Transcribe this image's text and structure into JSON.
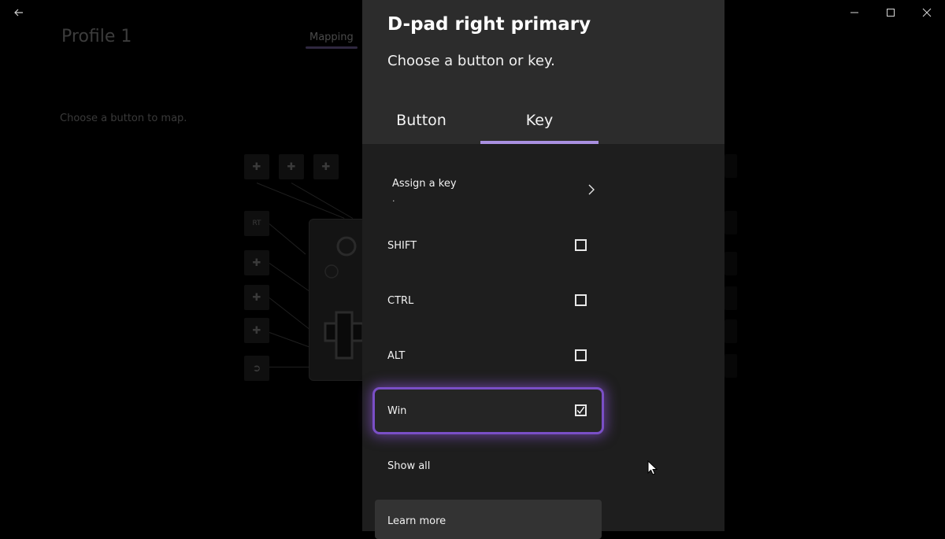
{
  "window": {
    "back_icon": "back-arrow-icon",
    "minimize_icon": "minimize-icon",
    "maximize_icon": "maximize-icon",
    "close_icon": "close-icon"
  },
  "background": {
    "profile_title": "Profile 1",
    "tab_mapping": "Mapping",
    "instruction": "Choose a button to map.",
    "indicator_ax": "RT"
  },
  "dialog": {
    "title": "D-pad right primary",
    "subtitle": "Choose a button or key.",
    "tabs": [
      {
        "label": "Button",
        "selected": false
      },
      {
        "label": "Key",
        "selected": true
      }
    ],
    "assign": {
      "label": "Assign a key",
      "value": "."
    },
    "modifiers": [
      {
        "label": "SHIFT",
        "checked": false,
        "focused": false
      },
      {
        "label": "CTRL",
        "checked": false,
        "focused": false
      },
      {
        "label": "ALT",
        "checked": false,
        "focused": false
      },
      {
        "label": "Win",
        "checked": true,
        "focused": true
      }
    ],
    "show_all": "Show all",
    "learn_more": "Learn more"
  },
  "colors": {
    "accent": "#a990e0",
    "focus_glow": "#7a4fc6",
    "panel_bg": "#1e1e1e",
    "header_bg": "#2c2c2c"
  }
}
